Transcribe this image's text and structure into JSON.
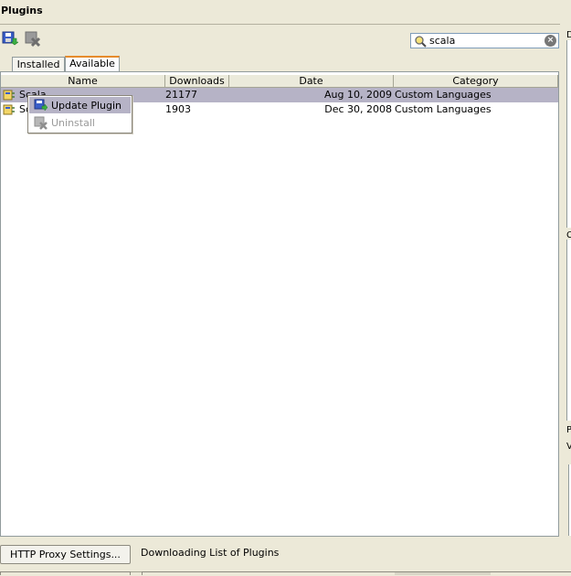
{
  "window": {
    "title": "Plugins"
  },
  "search": {
    "value": "scala"
  },
  "tabs": [
    {
      "label": "Installed"
    },
    {
      "label": "Available"
    }
  ],
  "table": {
    "columns": [
      "Name",
      "Downloads",
      "Date",
      "Category"
    ],
    "rows": [
      {
        "name": "Scala",
        "downloads": "21177",
        "date": "Aug 10, 2009",
        "category": "Custom Languages"
      },
      {
        "name": "Sc",
        "downloads": "1903",
        "date": "Dec 30, 2008",
        "category": "Custom Languages"
      }
    ]
  },
  "context_menu": {
    "items": [
      {
        "label": "Update Plugin",
        "icon": "update-plugin-icon",
        "enabled": true
      },
      {
        "label": "Uninstall",
        "icon": "uninstall-icon",
        "enabled": false
      }
    ]
  },
  "right_panel": {
    "labels": [
      "D",
      "C",
      "P",
      "V"
    ]
  },
  "footer": {
    "proxy_button_label": "HTTP Proxy Settings...",
    "status": "Downloading List of Plugins"
  },
  "colors": {
    "selection": "#b6b3c6",
    "tab_accent": "#e68b2c"
  }
}
